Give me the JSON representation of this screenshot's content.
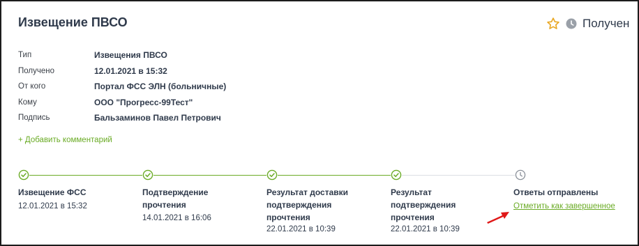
{
  "card": {
    "title": "Извещение ПВСО",
    "status": "Получен"
  },
  "meta": [
    {
      "label": "Тип",
      "value": "Извещения ПВСО"
    },
    {
      "label": "Получено",
      "value": "12.01.2021 в 15:32"
    },
    {
      "label": "От кого",
      "value": "Портал ФСС ЭЛН (больничные)"
    },
    {
      "label": "Кому",
      "value": "ООО \"Прогресс-99Тест\""
    },
    {
      "label": "Подпись",
      "value": "Бальзаминов Павел Петрович"
    }
  ],
  "add_comment_label": "+ Добавить комментарий",
  "timeline": {
    "steps": [
      {
        "title_lines": [
          "Извещение ФСС"
        ],
        "date": "12.01.2021 в 15:32",
        "done": true
      },
      {
        "title_lines": [
          "Подтверждение",
          "прочтения"
        ],
        "date": "14.01.2021 в 16:06",
        "done": true
      },
      {
        "title_lines": [
          "Результат доставки",
          "подтверждения",
          "прочтения"
        ],
        "date": "22.01.2021 в 10:39",
        "done": true
      },
      {
        "title_lines": [
          "Результат",
          "подтверждения",
          "прочтения"
        ],
        "date": "22.01.2021 в 10:39",
        "done": true
      },
      {
        "title_lines": [
          "Ответы отправлены"
        ],
        "date": "",
        "done": false
      }
    ],
    "mark_complete_label": "Отметить как завершенное"
  },
  "colors": {
    "accent_green": "#6aab25",
    "text_dark": "#2f3a4b",
    "star": "#e9a825",
    "pending_gray": "#9aa0a8",
    "annotation_red": "#e01818"
  }
}
